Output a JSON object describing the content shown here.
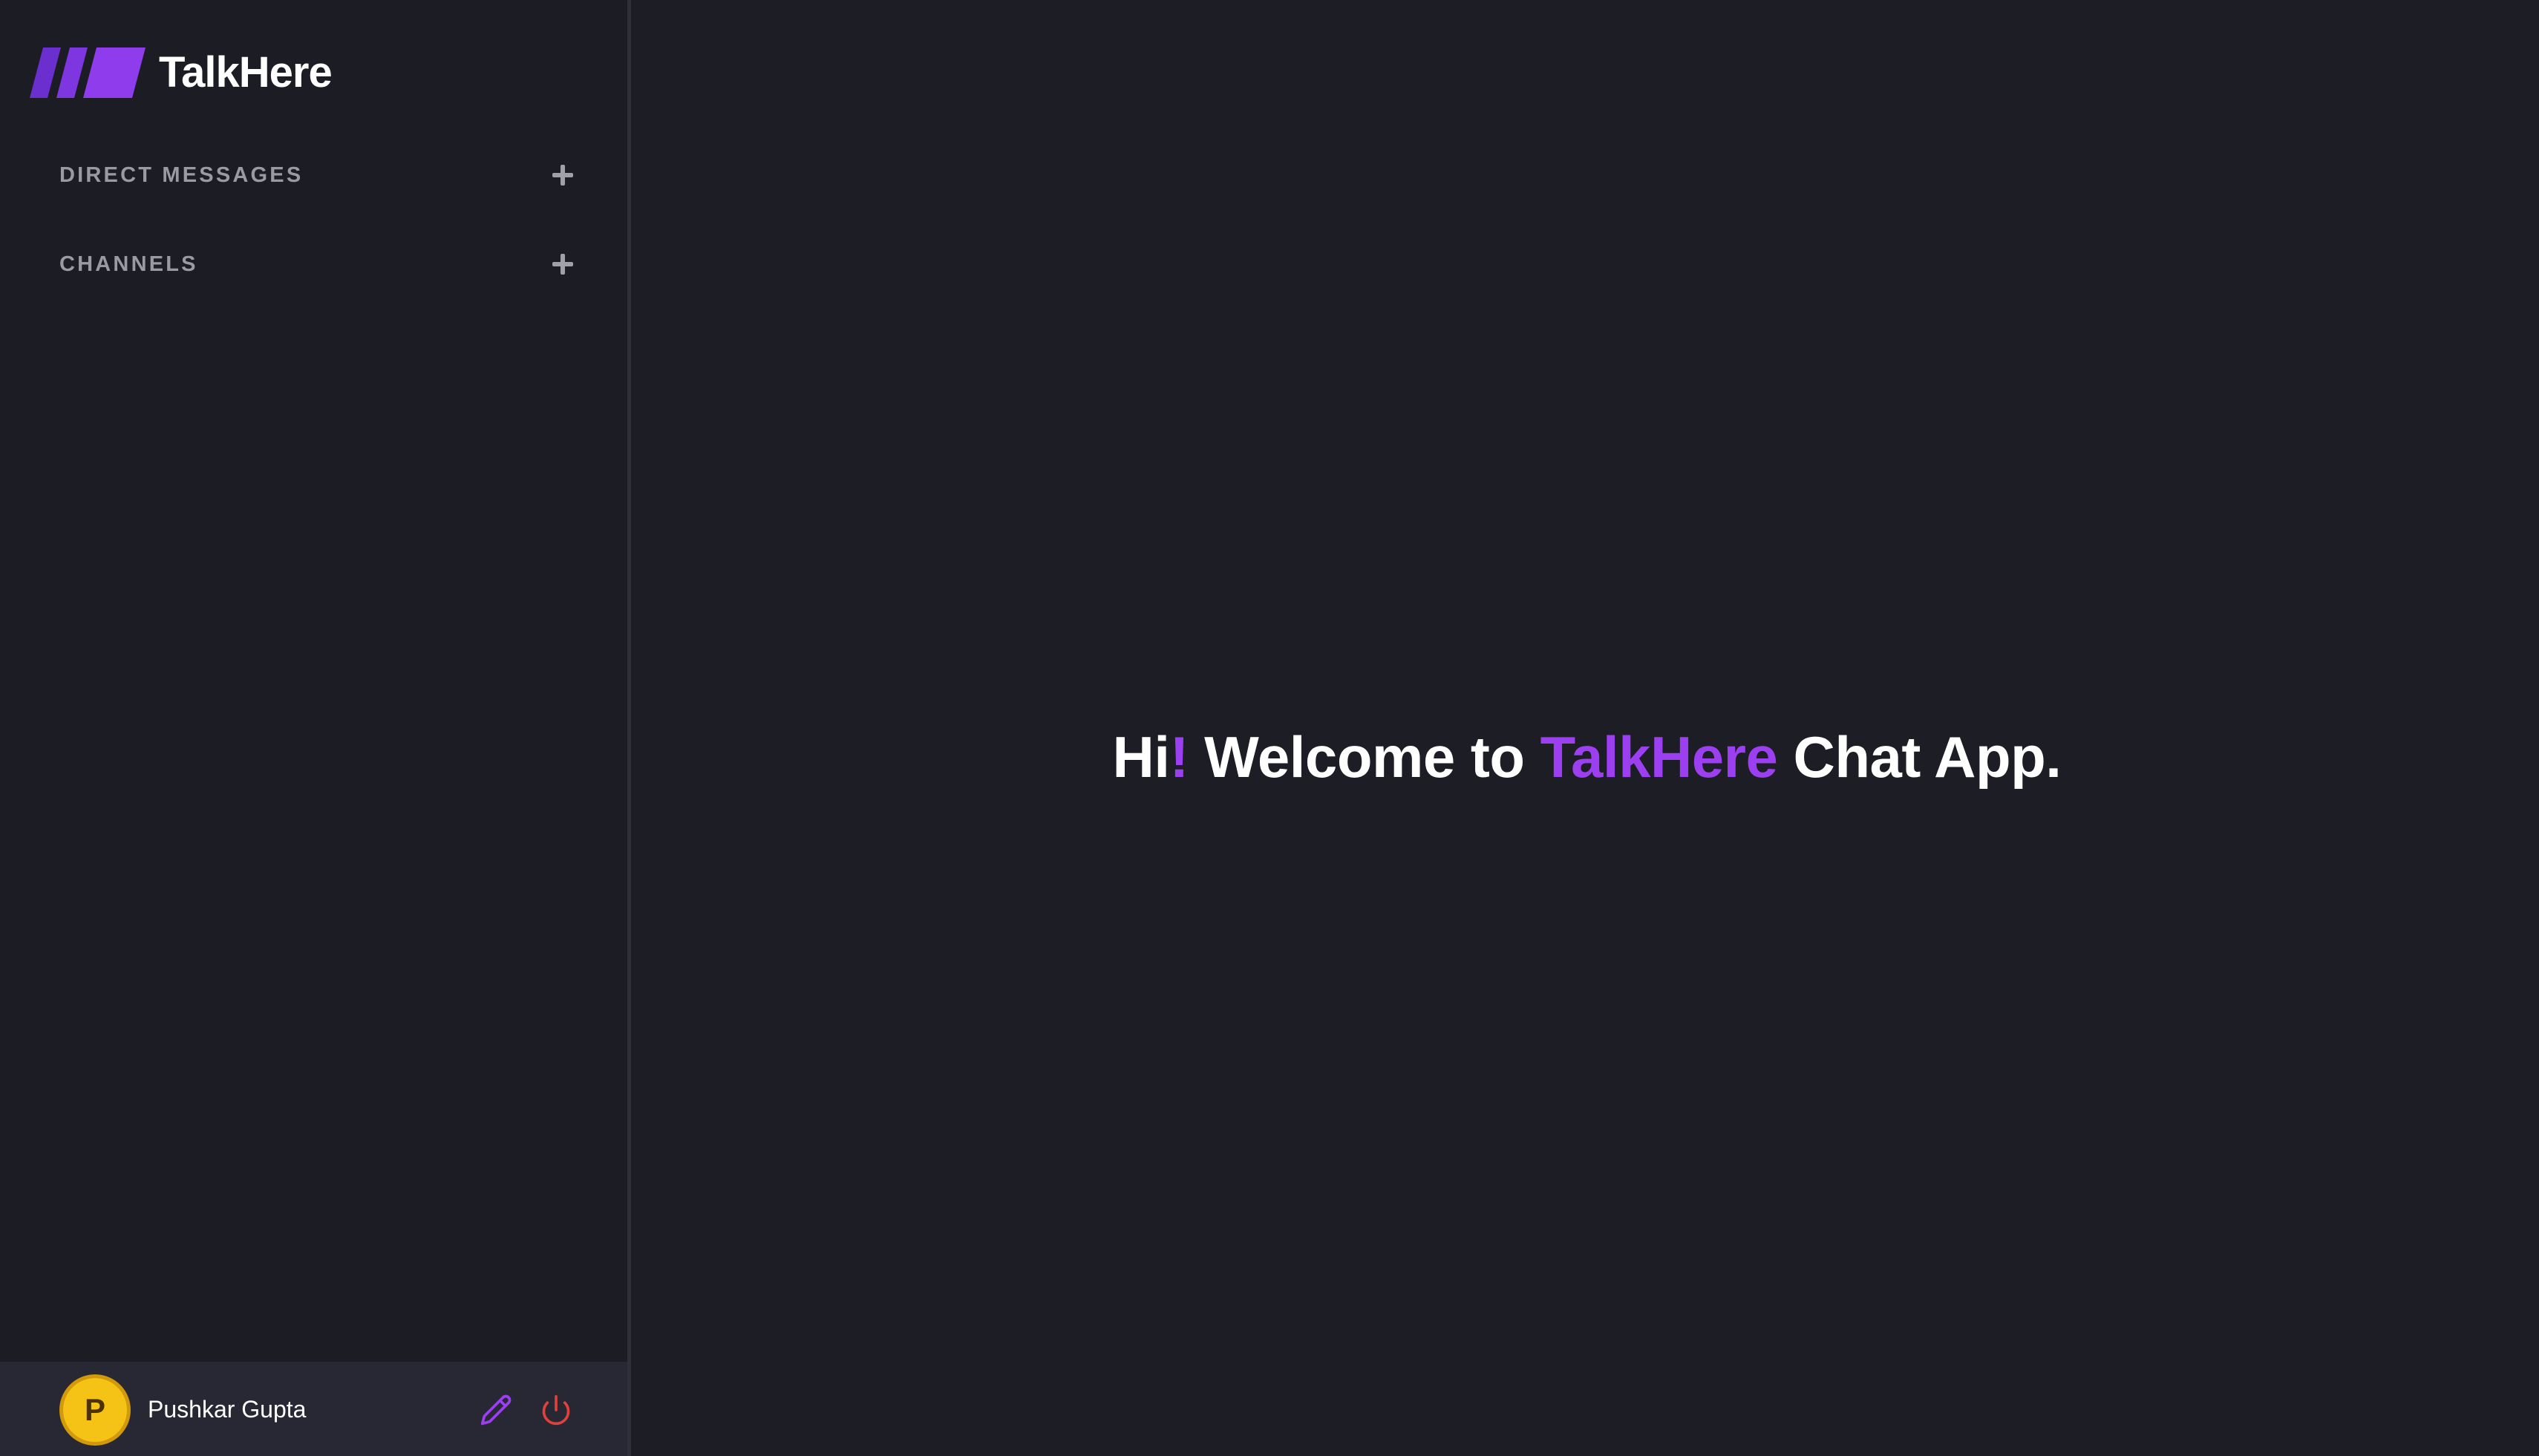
{
  "app": {
    "name": "TalkHere",
    "logo_icon": "slanted-bars-logo-icon"
  },
  "sidebar": {
    "sections": [
      {
        "title": "Direct Messages",
        "action_icon": "plus-icon"
      },
      {
        "title": "Channels",
        "action_icon": "plus-icon"
      }
    ],
    "user": {
      "avatar_initial": "P",
      "name": "Pushkar Gupta",
      "edit_icon": "pencil-icon",
      "logout_icon": "power-icon"
    }
  },
  "main": {
    "welcome": {
      "part1": "Hi",
      "exclaim": "!",
      "part2": " Welcome to ",
      "brand": "TalkHere",
      "part3": " Chat App."
    }
  },
  "colors": {
    "accent": "#9b3ff0",
    "background": "#1c1d25",
    "sidebar": "#1b1c24",
    "userbar": "#272833",
    "avatar": "#f5c316",
    "logout": "#e0413b"
  }
}
